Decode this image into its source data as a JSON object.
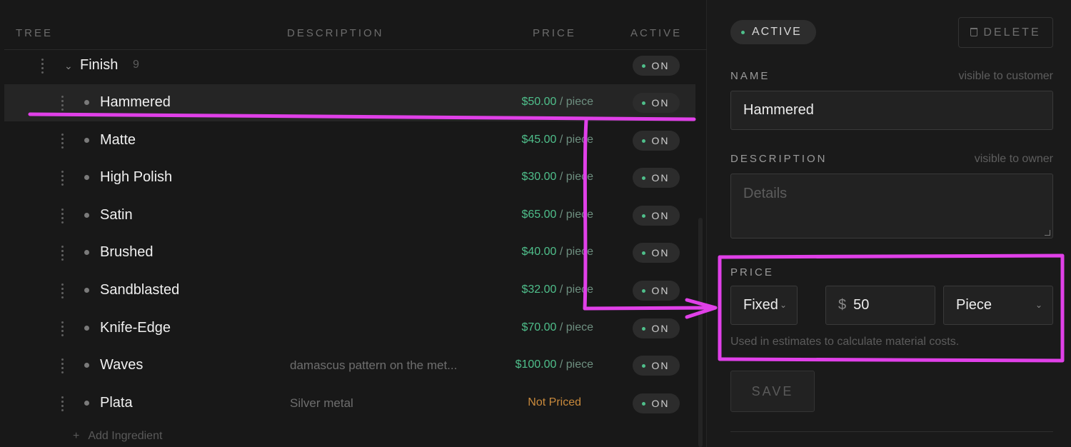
{
  "columns": {
    "tree": "TREE",
    "description": "DESCRIPTION",
    "price": "PRICE",
    "active": "ACTIVE"
  },
  "group": {
    "name": "Finish",
    "count": "9",
    "toggle": "ON"
  },
  "rows": [
    {
      "name": "Hammered",
      "description": "",
      "price": "$50.00",
      "unit": "/ piece",
      "toggle": "ON"
    },
    {
      "name": "Matte",
      "description": "",
      "price": "$45.00",
      "unit": "/ piece",
      "toggle": "ON"
    },
    {
      "name": "High Polish",
      "description": "",
      "price": "$30.00",
      "unit": "/ piece",
      "toggle": "ON"
    },
    {
      "name": "Satin",
      "description": "",
      "price": "$65.00",
      "unit": "/ piece",
      "toggle": "ON"
    },
    {
      "name": "Brushed",
      "description": "",
      "price": "$40.00",
      "unit": "/ piece",
      "toggle": "ON"
    },
    {
      "name": "Sandblasted",
      "description": "",
      "price": "$32.00",
      "unit": "/ piece",
      "toggle": "ON"
    },
    {
      "name": "Knife-Edge",
      "description": "",
      "price": "$70.00",
      "unit": "/ piece",
      "toggle": "ON"
    },
    {
      "name": "Waves",
      "description": "damascus pattern on the met...",
      "price": "$100.00",
      "unit": "/ piece",
      "toggle": "ON"
    },
    {
      "name": "Plata",
      "description": "Silver metal",
      "price_status": "Not Priced",
      "toggle": "ON"
    }
  ],
  "add_ingredient": {
    "icon": "+",
    "label": "Add Ingredient"
  },
  "detail": {
    "status": "ACTIVE",
    "delete_label": "DELETE",
    "name_label": "NAME",
    "name_hint": "visible to customer",
    "name_value": "Hammered",
    "description_label": "DESCRIPTION",
    "description_hint": "visible to owner",
    "description_placeholder": "Details",
    "price_label": "PRICE",
    "price_type": "Fixed",
    "currency": "$",
    "price_value": "50",
    "price_unit": "Piece",
    "price_help": "Used in estimates to calculate material costs.",
    "save_label": "SAVE"
  },
  "colors": {
    "accent_green": "#4fbf8b",
    "not_priced": "#c98a3c",
    "annotation": "#e040e8"
  },
  "icons": [
    "drag-handle-icon",
    "chevron-down-icon",
    "trash-icon",
    "plus-icon"
  ]
}
